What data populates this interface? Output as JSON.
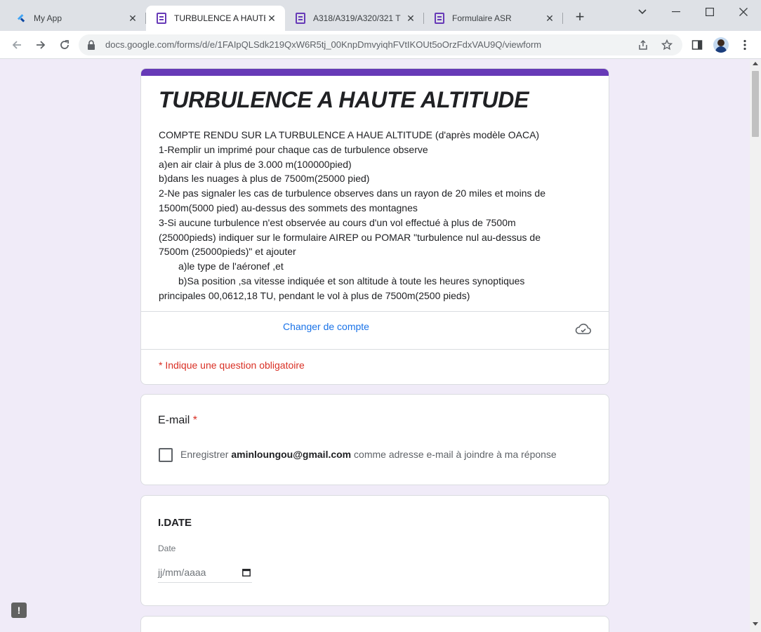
{
  "tabs": [
    {
      "title": "My App",
      "icon": "flutter-icon",
      "active": false
    },
    {
      "title": "TURBULENCE A HAUTE",
      "icon": "google-forms-icon",
      "active": true
    },
    {
      "title": "A318/A319/A320/321 T",
      "icon": "google-forms-icon",
      "active": false
    },
    {
      "title": "Formulaire ASR",
      "icon": "google-forms-icon",
      "active": false
    }
  ],
  "toolbar": {
    "url": "docs.google.com/forms/d/e/1FAIpQLSdk219QxW6R5tj_00KnpDmvyiqhFVtIKOUt5oOrzFdxVAU9Q/viewform"
  },
  "form": {
    "title": "TURBULENCE A HAUTE ALTITUDE",
    "description_lines": [
      "COMPTE RENDU SUR LA TURBULENCE A HAUE ALTITUDE (d'après modèle OACA)",
      "1-Remplir un imprimé pour chaque cas de turbulence observe",
      "a)en air clair à plus de 3.000 m(100000pied)",
      "b)dans les nuages à plus de 7500m(25000 pied)",
      "2-Ne pas signaler les cas de turbulence observes dans un rayon de 20 miles et moins de",
      "1500m(5000 pied) au-dessus des sommets des montagnes",
      "3-Si aucune turbulence n'est observée au cours d'un vol effectué à plus de 7500m",
      "(25000pieds) indiquer sur le formulaire AIREP ou POMAR \"turbulence nul au-dessus de",
      "7500m (25000pieds)\" et ajouter",
      "a)le type de l'aéronef ,et",
      "b)Sa position ,sa vitesse indiquée et son altitude  à toute les heures synoptiques",
      "principales 00,0612,18 TU, pendant le vol à plus de 7500m(2500 pieds)"
    ],
    "switch_account": "Changer de compte",
    "required_note": "* Indique une question obligatoire"
  },
  "email_question": {
    "title": "E-mail",
    "required_marker": "*",
    "checkbox_prefix": "Enregistrer",
    "email": "aminloungou@gmail.com",
    "checkbox_suffix": "comme adresse e-mail à joindre à ma réponse",
    "checked": false
  },
  "date_question": {
    "title": "I.DATE",
    "label": "Date",
    "placeholder": "jj/mm/aaaa"
  },
  "feedback": {
    "label": "!"
  },
  "colors": {
    "accent": "#673ab7",
    "page_background": "#f0ebf8",
    "link": "#1a73e8",
    "required": "#d93025"
  }
}
